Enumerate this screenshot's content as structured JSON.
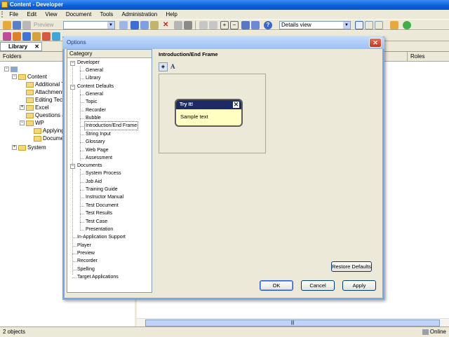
{
  "app": {
    "title": "Content - Developer"
  },
  "menu": [
    "File",
    "Edit",
    "View",
    "Document",
    "Tools",
    "Administration",
    "Help"
  ],
  "toolbar": {
    "preview_label": "Preview",
    "view_combo": "Details view"
  },
  "library": {
    "tab_label": "Library",
    "tab_close": "✕",
    "folders_header": "Folders",
    "roles_header": "Roles",
    "tree": [
      "Content",
      "Additional Top",
      "Attachments",
      "Editing Techni",
      "Excel",
      "Questions and",
      "WP",
      "Applying f",
      "Documen",
      "System"
    ]
  },
  "status": {
    "count": "2 objects",
    "mode": "Online"
  },
  "dialog": {
    "title": "Options",
    "close": "✕",
    "category_header": "Category",
    "categories": [
      "Developer",
      "General",
      "Library",
      "Content Defaults",
      "General",
      "Topic",
      "Recorder",
      "Bubble",
      "Introduction/End Frame",
      "String Input",
      "Glossary",
      "Web Page",
      "Assessment",
      "Documents",
      "System Process",
      "Job Aid",
      "Training Guide",
      "Instructor Manual",
      "Test Document",
      "Test Results",
      "Test Case",
      "Presentation",
      "In-Application Support",
      "Player",
      "Preview",
      "Recorder",
      "Spelling",
      "Target Applications"
    ],
    "section_title": "Introduction/End Frame",
    "font_button": "A",
    "bubble": {
      "title": "Try It!",
      "close": "✕",
      "text": "Sample text"
    },
    "restore_label": "Restore Defaults",
    "ok_label": "OK",
    "cancel_label": "Cancel",
    "apply_label": "Apply"
  }
}
